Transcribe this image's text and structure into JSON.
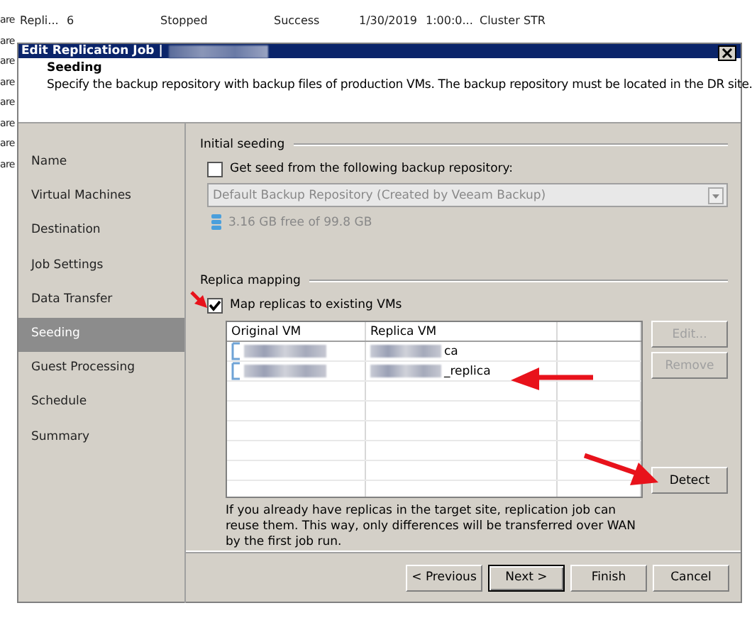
{
  "background_table": {
    "rows": [
      {
        "cells": [
          "are",
          "Repli...",
          "6",
          "Stopped",
          "Success",
          "1/30/2019",
          "1:00:0...",
          "Cluster STR"
        ]
      },
      {
        "cells": [
          "are"
        ]
      },
      {
        "cells": [
          "are"
        ]
      },
      {
        "cells": [
          "are"
        ]
      },
      {
        "cells": [
          "are"
        ]
      },
      {
        "cells": [
          "are"
        ]
      },
      {
        "cells": [
          "are"
        ]
      },
      {
        "cells": [
          "are"
        ]
      }
    ]
  },
  "dialog": {
    "title": "Edit Replication Job |",
    "header": {
      "title": "Seeding",
      "description": "Specify the backup repository with backup files of production VMs. The backup repository must be located in the DR site."
    },
    "steps": [
      {
        "label": "Name",
        "selected": false
      },
      {
        "label": "Virtual Machines",
        "selected": false
      },
      {
        "label": "Destination",
        "selected": false
      },
      {
        "label": "Job Settings",
        "selected": false
      },
      {
        "label": "Data Transfer",
        "selected": false
      },
      {
        "label": "Seeding",
        "selected": true
      },
      {
        "label": "Guest Processing",
        "selected": false
      },
      {
        "label": "Schedule",
        "selected": false
      },
      {
        "label": "Summary",
        "selected": false
      }
    ],
    "initial_seeding": {
      "legend": "Initial seeding",
      "checkbox": {
        "label": "Get seed from the following backup repository:",
        "checked": false
      },
      "repository": {
        "value": "Default Backup Repository (Created by Veeam Backup)",
        "disabled": true
      },
      "free_space": "3.16 GB free of 99.8 GB"
    },
    "replica_mapping": {
      "legend": "Replica mapping",
      "checkbox": {
        "label": "Map replicas to existing VMs",
        "checked": true
      },
      "table": {
        "columns": [
          "Original VM",
          "Replica VM"
        ],
        "rows": [
          {
            "replica_vm": "ca"
          },
          {
            "replica_vm": "_replica"
          }
        ]
      },
      "buttons": [
        {
          "label": "Edit...",
          "disabled": true
        },
        {
          "label": "Remove",
          "disabled": true
        },
        {
          "label": "Detect",
          "disabled": false
        }
      ],
      "note": "If you already have replicas in the target site, replication job can reuse them. This way, only differences will be transferred over WAN by the first job run."
    },
    "footer_buttons": [
      {
        "label": "< Previous",
        "default": false
      },
      {
        "label": "Next >",
        "default": true
      },
      {
        "label": "Finish",
        "default": false
      },
      {
        "label": "Cancel",
        "default": false
      }
    ]
  }
}
